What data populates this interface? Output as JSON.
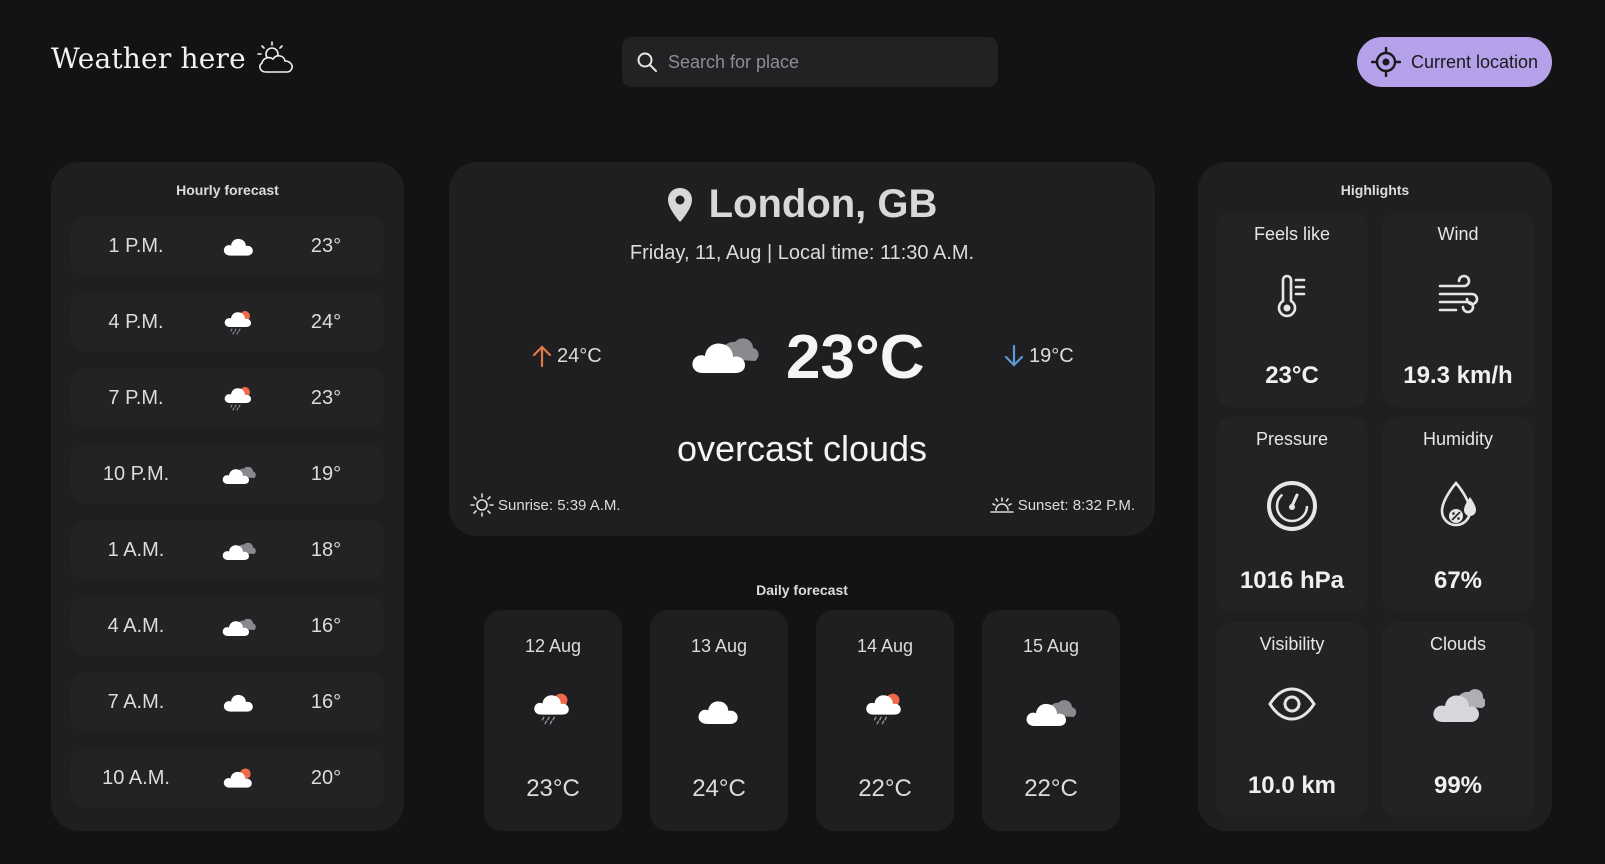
{
  "header": {
    "logo_text": "Weather here",
    "search_placeholder": "Search for place",
    "location_button": "Current location"
  },
  "hourly": {
    "title": "Hourly forecast",
    "items": [
      {
        "time": "1 P.M.",
        "icon": "cloud-icon",
        "temp": "23°"
      },
      {
        "time": "4 P.M.",
        "icon": "rain-sun-icon",
        "temp": "24°"
      },
      {
        "time": "7 P.M.",
        "icon": "rain-sun-icon",
        "temp": "23°"
      },
      {
        "time": "10 P.M.",
        "icon": "overcast-icon",
        "temp": "19°"
      },
      {
        "time": "1 A.M.",
        "icon": "overcast-icon",
        "temp": "18°"
      },
      {
        "time": "4 A.M.",
        "icon": "overcast-icon",
        "temp": "16°"
      },
      {
        "time": "7 A.M.",
        "icon": "cloud-icon",
        "temp": "16°"
      },
      {
        "time": "10 A.M.",
        "icon": "sun-cloud-icon",
        "temp": "20°"
      }
    ]
  },
  "current": {
    "city": "London, GB",
    "datetime": "Friday, 11, Aug | Local time: 11:30 A.M.",
    "temp_max": "24°C",
    "temp_min": "19°C",
    "temp": "23°C",
    "description": "overcast clouds",
    "sunrise": "Sunrise: 5:39 A.M.",
    "sunset": "Sunset: 8:32 P.M."
  },
  "daily": {
    "title": "Daily forecast",
    "items": [
      {
        "date": "12 Aug",
        "icon": "rain-sun-icon",
        "temp": "23°C"
      },
      {
        "date": "13 Aug",
        "icon": "cloud-icon",
        "temp": "24°C"
      },
      {
        "date": "14 Aug",
        "icon": "rain-sun-icon",
        "temp": "22°C"
      },
      {
        "date": "15 Aug",
        "icon": "overcast-icon",
        "temp": "22°C"
      }
    ]
  },
  "highlights": {
    "title": "Highlights",
    "feels_like": {
      "label": "Feels like",
      "value": "23°C",
      "icon": "thermometer-icon"
    },
    "wind": {
      "label": "Wind",
      "value": "19.3 km/h",
      "icon": "wind-icon"
    },
    "pressure": {
      "label": "Pressure",
      "value": "1016 hPa",
      "icon": "gauge-icon"
    },
    "humidity": {
      "label": "Humidity",
      "value": "67%",
      "icon": "humidity-icon"
    },
    "visibility": {
      "label": "Visibility",
      "value": "10.0 km",
      "icon": "eye-icon"
    },
    "clouds": {
      "label": "Clouds",
      "value": "99%",
      "icon": "clouds-icon"
    }
  },
  "colors": {
    "background": "#131315",
    "card": "#1f1f21",
    "accent": "#b5a1ea",
    "max_arrow": "#e0794a",
    "min_arrow": "#5b9bd5",
    "sun": "#ee6a4b"
  }
}
